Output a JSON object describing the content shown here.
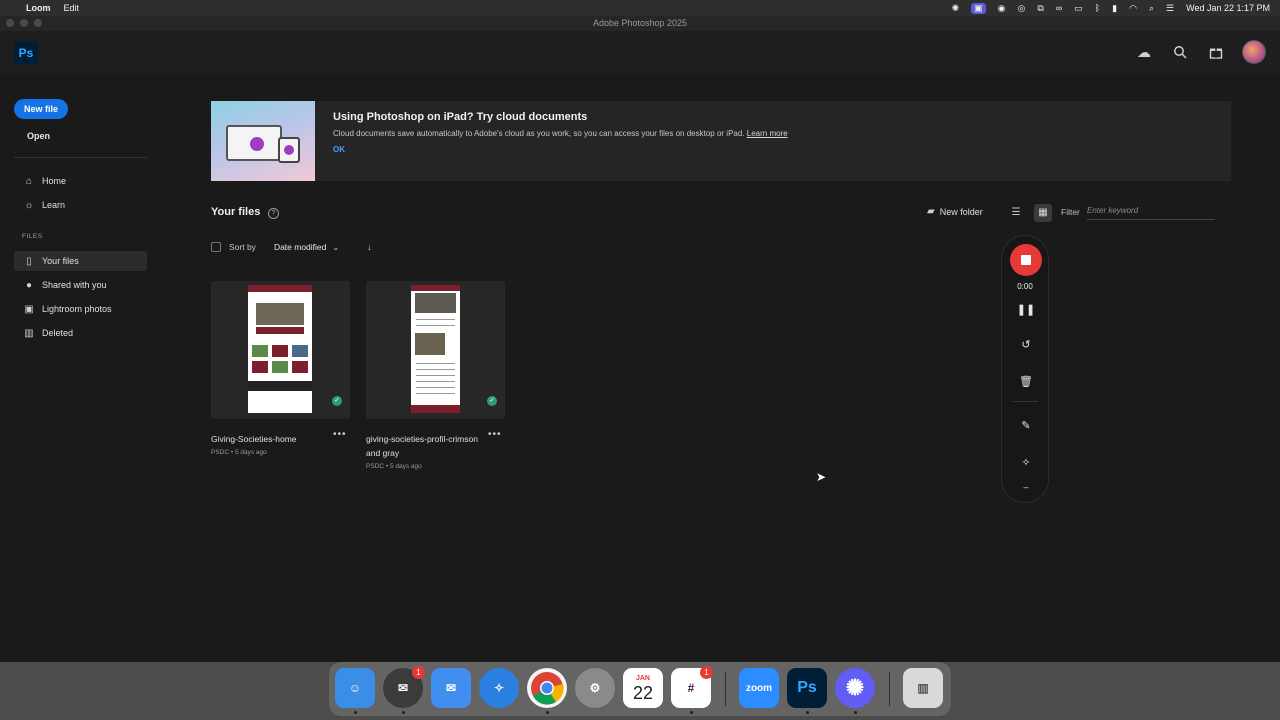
{
  "menubar": {
    "app_name": "Loom",
    "menus": [
      "Edit"
    ],
    "clock": "Wed Jan 22  1:17 PM",
    "icons": [
      "loom-status-icon",
      "screen-record-icon",
      "chrome-status-icon",
      "grammarly-icon",
      "screen-mirror-icon",
      "link-icon",
      "folder-icon",
      "bluetooth-icon",
      "battery-icon",
      "wifi-icon",
      "spotlight-icon",
      "control-center-icon"
    ]
  },
  "window": {
    "title": "Adobe Photoshop 2025"
  },
  "header": {
    "logo": "Ps",
    "icons": [
      "cloud-icon",
      "search-icon",
      "gift-icon",
      "avatar"
    ]
  },
  "sidebar": {
    "new_file": "New file",
    "open": "Open",
    "nav": [
      {
        "label": "Home",
        "icon": "home-icon"
      },
      {
        "label": "Learn",
        "icon": "lightbulb-icon"
      }
    ],
    "files_caption": "FILES",
    "files_nav": [
      {
        "label": "Your files",
        "icon": "file-icon",
        "active": true
      },
      {
        "label": "Shared with you",
        "icon": "people-icon"
      },
      {
        "label": "Lightroom photos",
        "icon": "lightroom-icon"
      },
      {
        "label": "Deleted",
        "icon": "trash-icon"
      }
    ]
  },
  "banner": {
    "title": "Using Photoshop on iPad? Try cloud documents",
    "description": "Cloud documents save automatically to Adobe's cloud as you work, so you can access your files on desktop or iPad.",
    "learn_more": "Learn more",
    "ok": "OK"
  },
  "files": {
    "title": "Your files",
    "new_folder": "New folder",
    "filter_label": "Filter",
    "filter_placeholder": "Enter keyword",
    "sort_label": "Sort by",
    "sort_value": "Date modified",
    "items": [
      {
        "name": "Giving-Societies-home",
        "meta": "PSDC • 5 days ago",
        "synced": true
      },
      {
        "name": "giving-societies-profil-crimson and gray",
        "meta": "PSDC • 5 days ago",
        "synced": true
      }
    ]
  },
  "loom": {
    "time": "0:00",
    "controls": [
      "stop-button",
      "pause-button",
      "restart-button",
      "delete-button",
      "draw-button",
      "effects-button"
    ]
  },
  "dock": {
    "apps": [
      {
        "name": "Finder",
        "color": "#3a8ee6"
      },
      {
        "name": "Mail Notifier",
        "color": "#3b3b3b",
        "badge": "1"
      },
      {
        "name": "Mail",
        "color": "#3f8ef0"
      },
      {
        "name": "Safari",
        "color": "#2a7fe0"
      },
      {
        "name": "Chrome",
        "color": "#f5f5f5"
      },
      {
        "name": "System Settings",
        "color": "#8a8a8a"
      },
      {
        "name": "Calendar",
        "color": "#ffffff",
        "month": "JAN",
        "day": "22"
      },
      {
        "name": "Slack",
        "color": "#ffffff",
        "badge": "1"
      },
      {
        "name": "Zoom",
        "color": "#2d8cff",
        "label": "zoom"
      },
      {
        "name": "Photoshop",
        "color": "#001e36",
        "label": "Ps"
      },
      {
        "name": "Loom",
        "color": "#625df5"
      },
      {
        "name": "Trash",
        "color": "#d9d9d9"
      }
    ]
  }
}
